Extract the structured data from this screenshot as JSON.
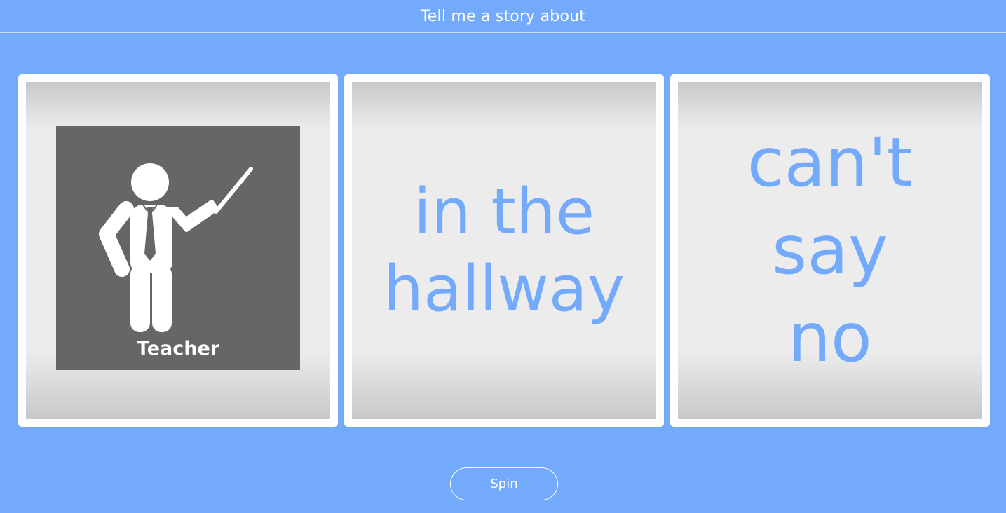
{
  "header": {
    "title": "Tell me a story about"
  },
  "reels": [
    {
      "type": "picture",
      "icon": "teacher-icon",
      "label": "Teacher"
    },
    {
      "type": "text",
      "text": "in the hallway"
    },
    {
      "type": "text",
      "text": "can't say no"
    }
  ],
  "spin_button": {
    "label": "Spin"
  },
  "colors": {
    "background": "#74aafc",
    "reel_text": "#74aafc",
    "picture_card": "#666666"
  }
}
